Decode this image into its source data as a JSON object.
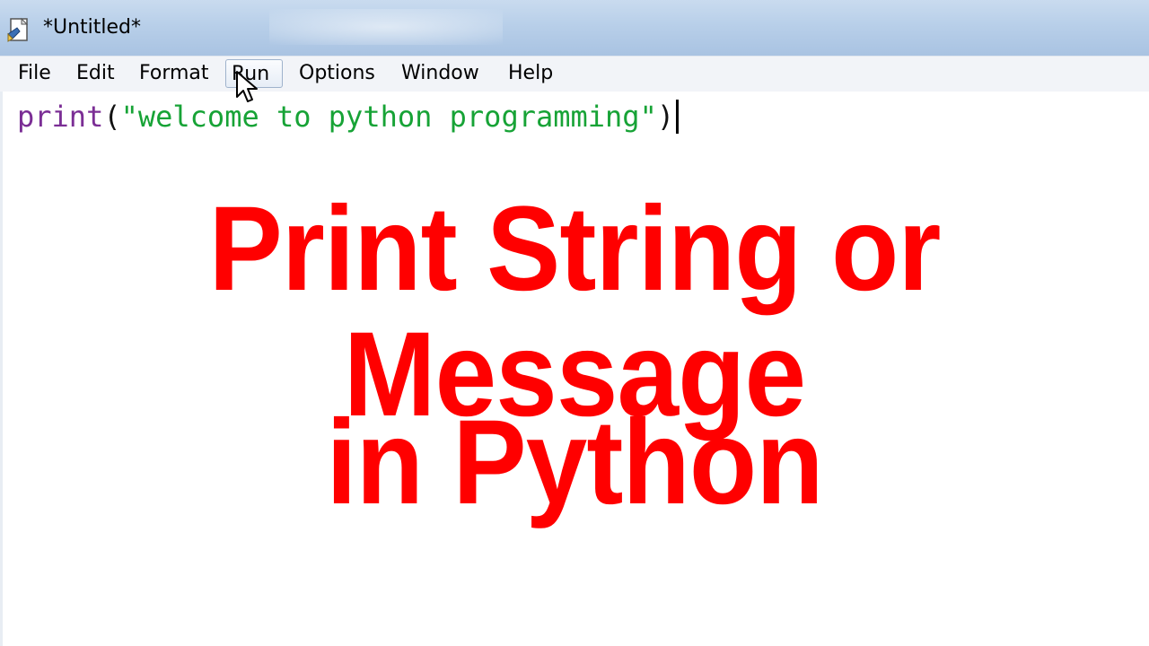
{
  "window": {
    "title": "*Untitled*",
    "icon": "python-idle-file-icon"
  },
  "menubar": {
    "items": [
      {
        "label": "File"
      },
      {
        "label": "Edit"
      },
      {
        "label": "Format"
      },
      {
        "label": "Run"
      },
      {
        "label": "Options"
      },
      {
        "label": "Window"
      },
      {
        "label": "Help"
      }
    ],
    "hovered": "Run"
  },
  "editor": {
    "code": {
      "keyword": "print",
      "open": "(",
      "string": "\"welcome to python programming\"",
      "close": ")"
    }
  },
  "overlay": {
    "line1": "Print String or Message",
    "line2": "in Python"
  },
  "colors": {
    "keyword": "#7b2e95",
    "string": "#17a336",
    "headline": "#ff0000",
    "titlebar": "#b8cfe9"
  }
}
